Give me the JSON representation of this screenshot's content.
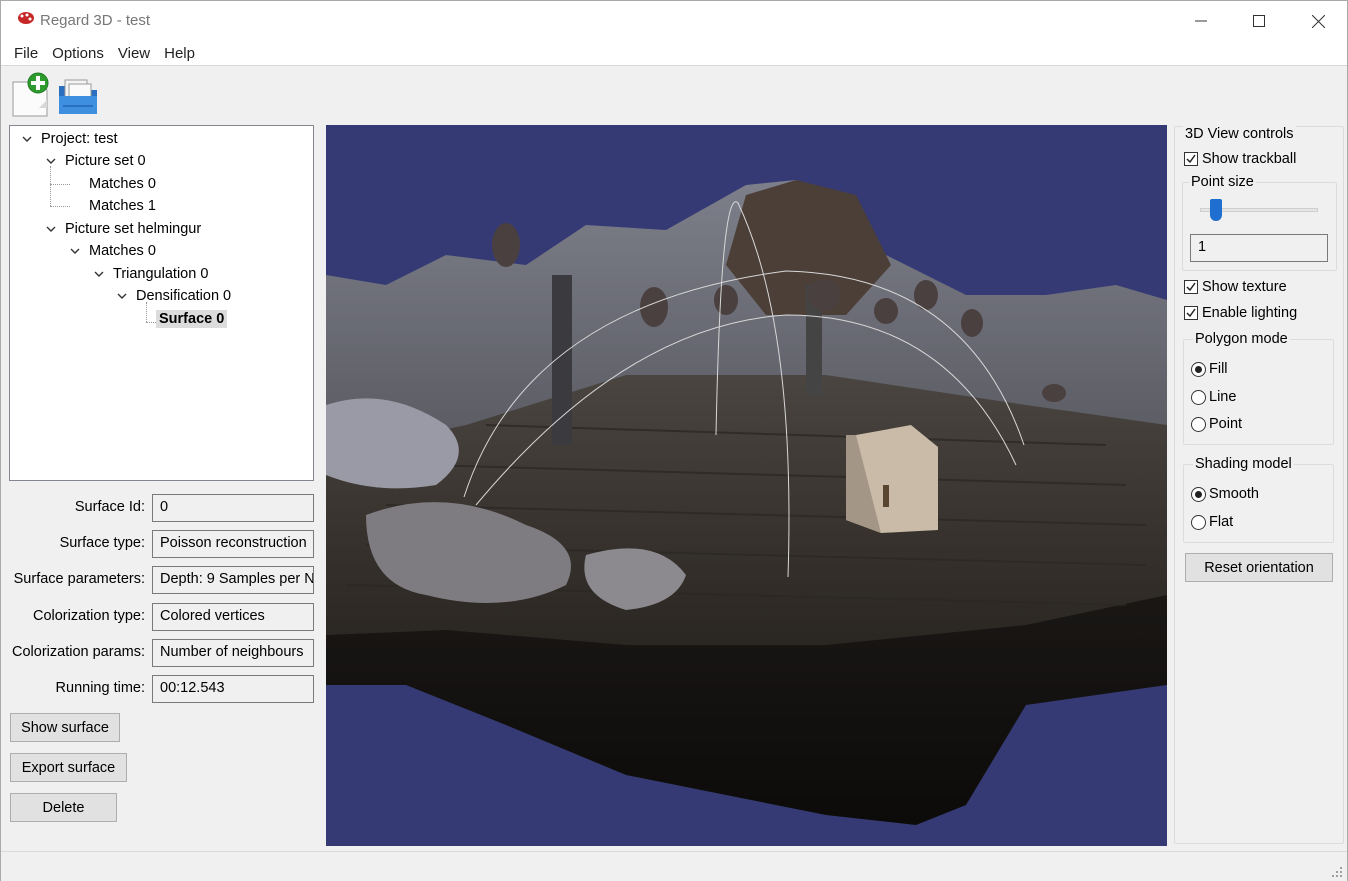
{
  "window": {
    "title": "Regard 3D - test",
    "controls": {
      "minimize": "minimize",
      "maximize": "maximize",
      "close": "close"
    }
  },
  "menu": [
    "File",
    "Options",
    "View",
    "Help"
  ],
  "toolbar": {
    "new_project_icon": "new-project-icon",
    "open_project_icon": "open-folder-icon"
  },
  "tree": {
    "project": "Project: test",
    "picture_set_0": "Picture set 0",
    "matches_0a": "Matches 0",
    "matches_1": "Matches 1",
    "picture_set_helmingur": "Picture set helmingur",
    "matches_0b": "Matches 0",
    "triangulation_0": "Triangulation 0",
    "densification_0": "Densification 0",
    "surface_0": "Surface 0"
  },
  "properties": {
    "surface_id_label": "Surface Id:",
    "surface_id": "0",
    "surface_type_label": "Surface type:",
    "surface_type": "Poisson reconstruction",
    "surface_params_label": "Surface parameters:",
    "surface_params": "Depth: 9 Samples per N",
    "colorization_type_label": "Colorization type:",
    "colorization_type": "Colored vertices",
    "colorization_params_label": "Colorization params:",
    "colorization_params": "Number of neighbours",
    "running_time_label": "Running time:",
    "running_time": "00:12.543"
  },
  "buttons": {
    "show_surface": "Show surface",
    "export_surface": "Export surface",
    "delete": "Delete"
  },
  "controls": {
    "title": "3D View controls",
    "show_trackball": "Show trackball",
    "point_size_title": "Point size",
    "point_size_value": "1",
    "point_size_slider_fraction": 0.1,
    "show_texture": "Show texture",
    "enable_lighting": "Enable lighting",
    "polygon_mode_title": "Polygon mode",
    "polygon_fill": "Fill",
    "polygon_line": "Line",
    "polygon_point": "Point",
    "shading_model_title": "Shading model",
    "shading_smooth": "Smooth",
    "shading_flat": "Flat",
    "reset_orientation": "Reset orientation"
  },
  "colors": {
    "viewport_bg": "#353a75",
    "accent_blue": "#1f6fd0"
  }
}
